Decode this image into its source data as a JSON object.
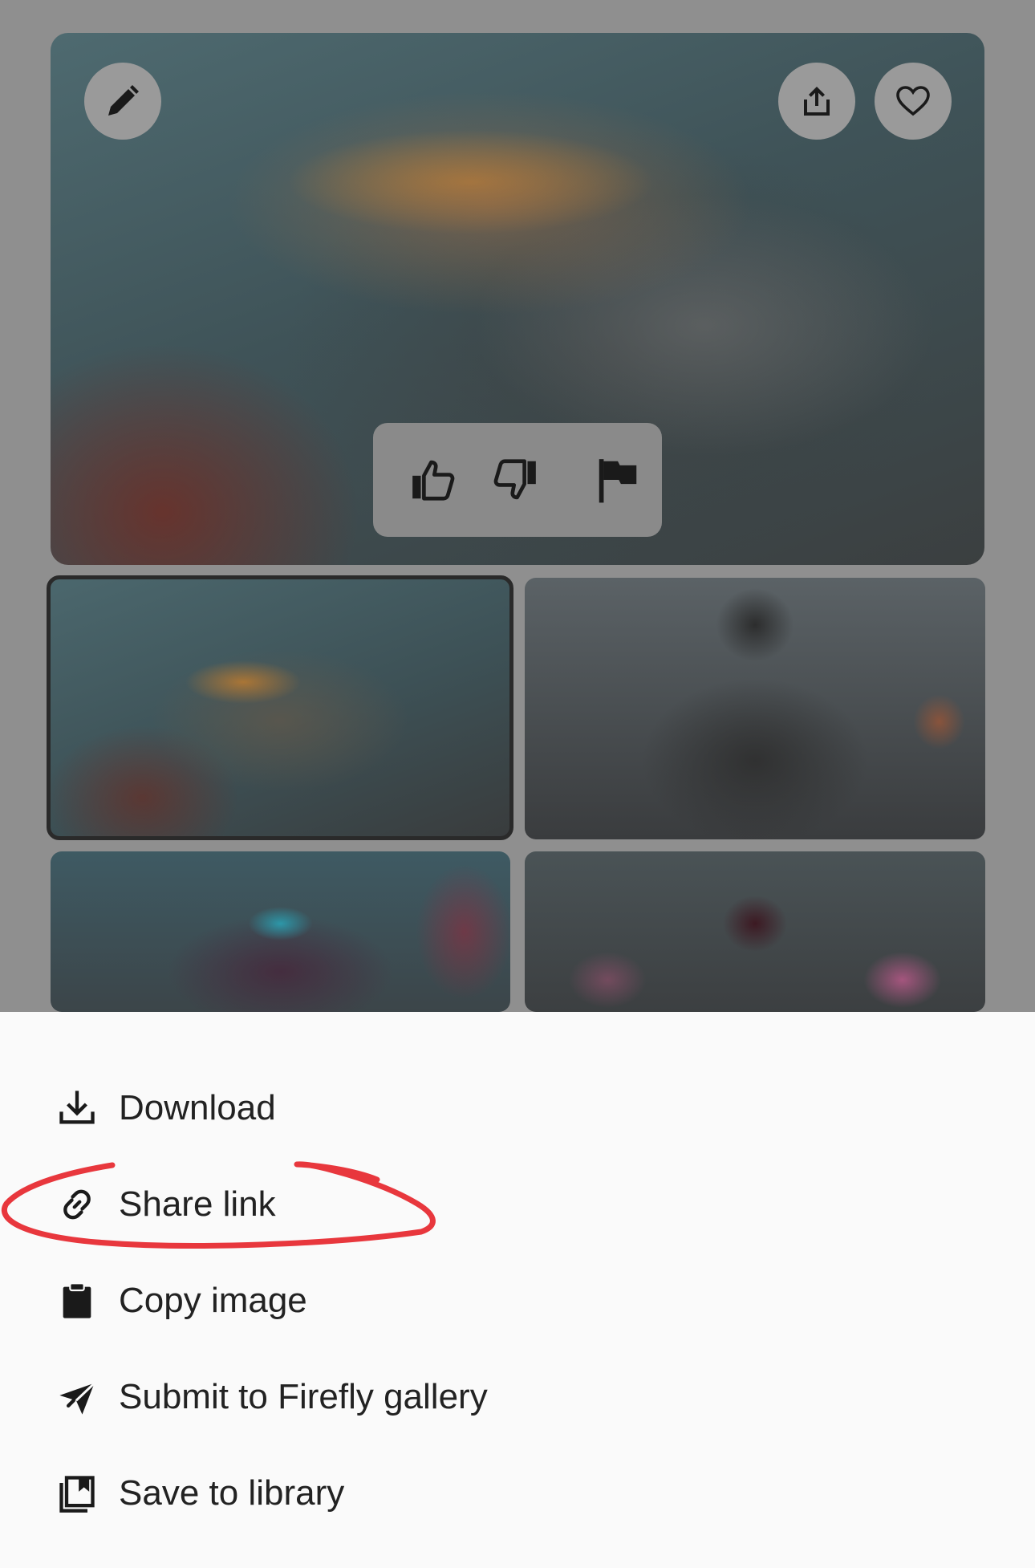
{
  "hero": {
    "edit_icon": "pencil-icon",
    "share_icon": "share-icon",
    "favorite_icon": "heart-icon",
    "feedback": {
      "like_icon": "thumbs-up-icon",
      "dislike_icon": "thumbs-down-icon",
      "report_icon": "flag-icon"
    }
  },
  "thumbnails": [
    {
      "selected": true
    },
    {
      "selected": false
    },
    {
      "selected": false
    },
    {
      "selected": false
    }
  ],
  "menu": {
    "items": [
      {
        "label": "Download",
        "icon": "download-icon"
      },
      {
        "label": "Share link",
        "icon": "link-icon"
      },
      {
        "label": "Copy image",
        "icon": "clipboard-icon"
      },
      {
        "label": "Submit to Firefly gallery",
        "icon": "paper-plane-icon"
      },
      {
        "label": "Save to library",
        "icon": "library-icon"
      }
    ]
  },
  "colors": {
    "overlay": "#8f8f8f",
    "sheet": "#fafafa",
    "highlight": "#e8373d",
    "text": "#222222"
  }
}
